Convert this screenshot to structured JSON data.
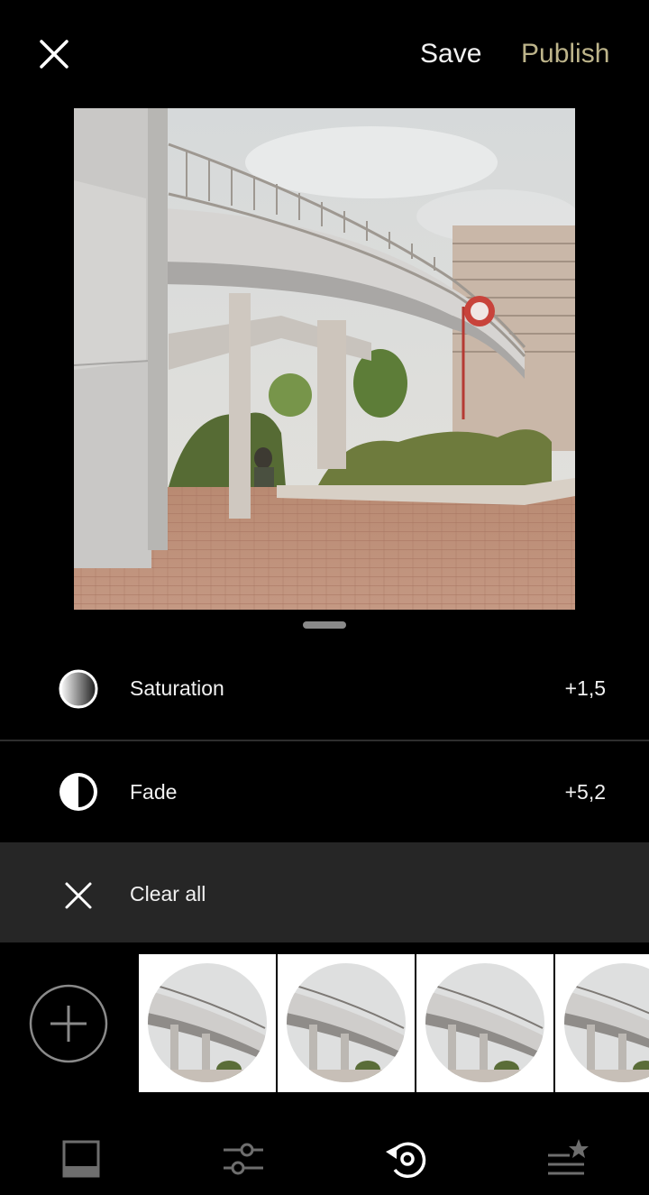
{
  "header": {
    "close_icon": "close-icon",
    "save_label": "Save",
    "publish_label": "Publish",
    "publish_color": "#bdb48a"
  },
  "adjustments": [
    {
      "label": "Saturation",
      "value": "+1,5",
      "icon": "saturation-icon"
    },
    {
      "label": "Fade",
      "value": "+5,2",
      "icon": "fade-icon"
    }
  ],
  "clear_all": {
    "label": "Clear all",
    "icon": "close-icon"
  },
  "presets": {
    "add_icon": "plus-circle-icon",
    "thumbnail_count": 4
  },
  "bottom_tabs": [
    {
      "icon": "presets-square-icon",
      "active": false
    },
    {
      "icon": "sliders-icon",
      "active": false
    },
    {
      "icon": "history-rotate-icon",
      "active": true
    },
    {
      "icon": "recipes-star-list-icon",
      "active": false
    }
  ],
  "colors": {
    "background": "#000000",
    "panel": "#262626",
    "text": "#f1f1f1",
    "accent": "#bdb48a"
  }
}
